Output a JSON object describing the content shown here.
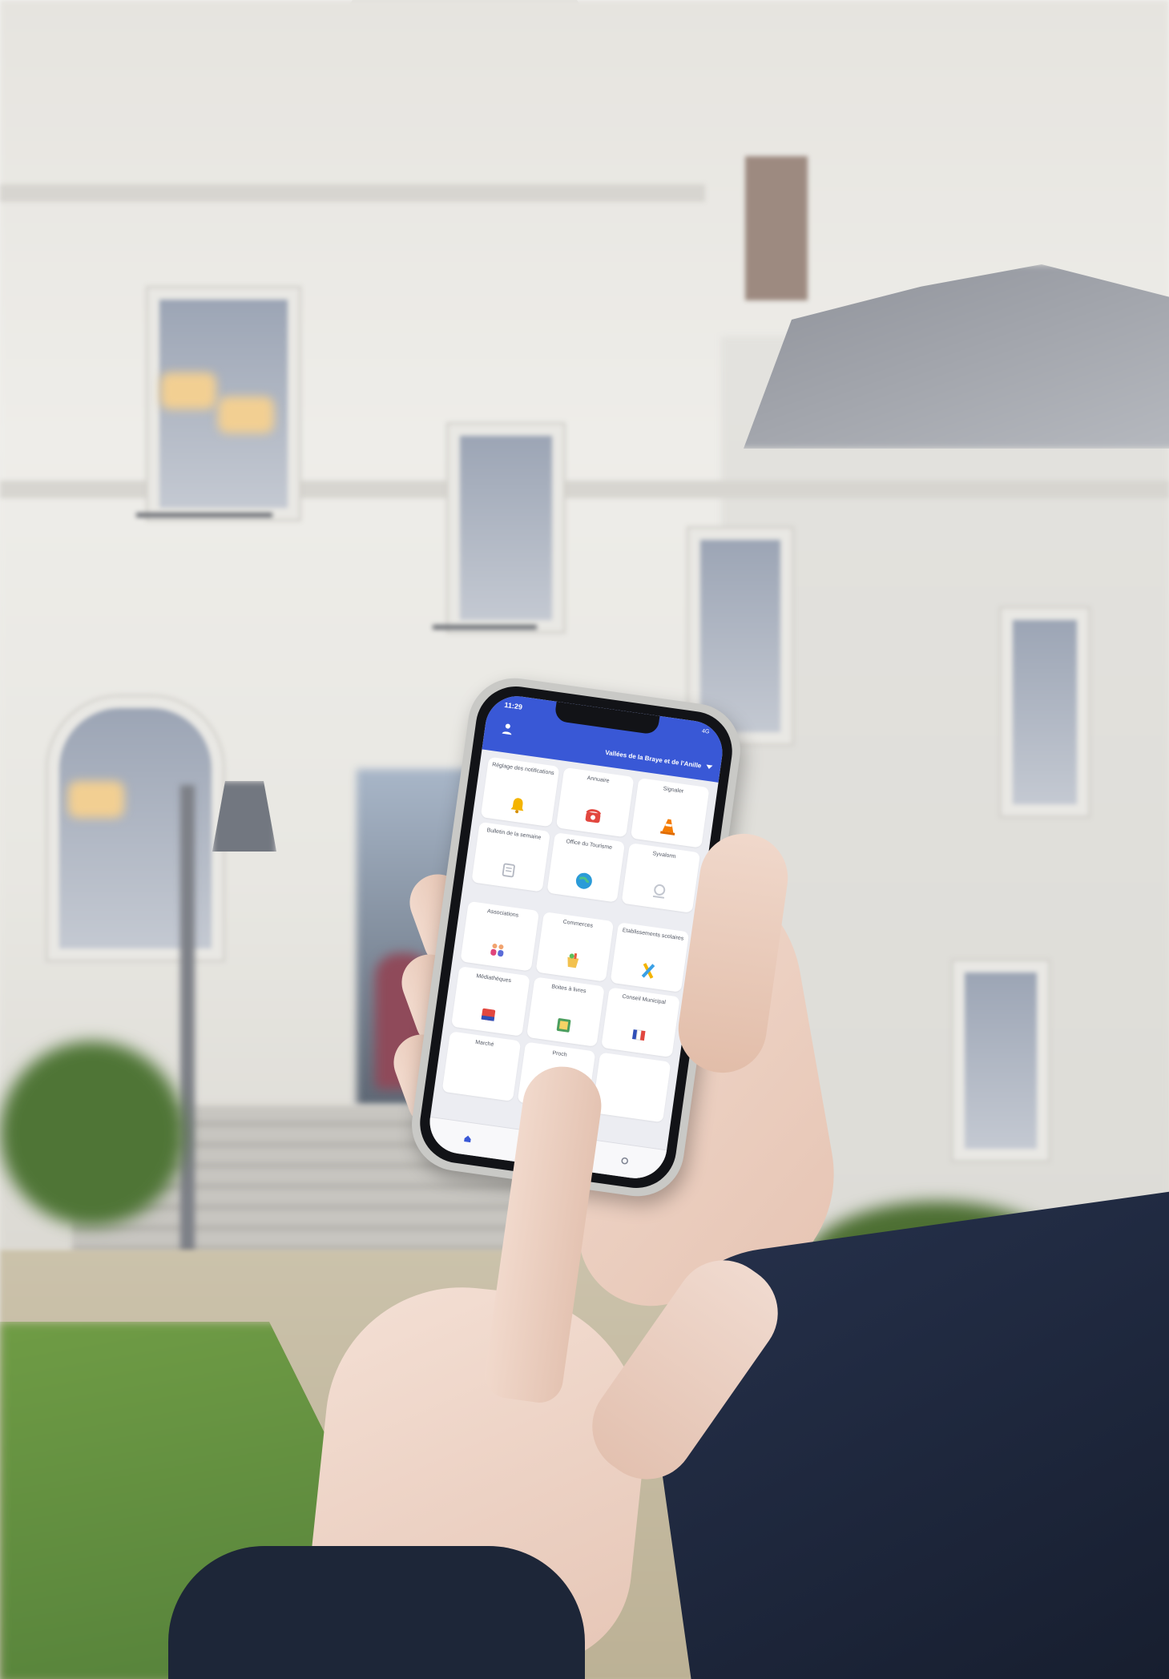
{
  "status_bar": {
    "time": "11:29",
    "network": "4G"
  },
  "header": {
    "commune": "Vallées de la Braye et de l'Anille"
  },
  "tiles_top": [
    {
      "label": "Réglage des notifications",
      "icon": "bell-icon"
    },
    {
      "label": "Annuaire",
      "icon": "phone-icon"
    },
    {
      "label": "Signaler",
      "icon": "traffic-cone-icon"
    },
    {
      "label": "Bulletin de la semaine",
      "icon": "newspaper-icon"
    },
    {
      "label": "Office du Tourisme",
      "icon": "globe-icon"
    },
    {
      "label": "Syvalorm",
      "icon": "syvalorm-logo"
    }
  ],
  "tiles_bottom": [
    {
      "label": "Associations",
      "icon": "people-icon"
    },
    {
      "label": "Commerces",
      "icon": "shopping-bag-icon"
    },
    {
      "label": "Etablissements scolaires",
      "icon": "pencil-ruler-icon"
    },
    {
      "label": "Médiathèques",
      "icon": "books-icon"
    },
    {
      "label": "Boites à livres",
      "icon": "book-box-icon"
    },
    {
      "label": "Conseil Municipal",
      "icon": "flag-icon"
    },
    {
      "label": "Marché",
      "icon": "market-icon"
    },
    {
      "label": "Proch",
      "icon": "pin-icon"
    },
    {
      "label": "",
      "icon": ""
    }
  ],
  "colors": {
    "header_blue": "#3958d6",
    "tile_bg": "#ffffff",
    "screen_bg": "#ecedf2"
  }
}
